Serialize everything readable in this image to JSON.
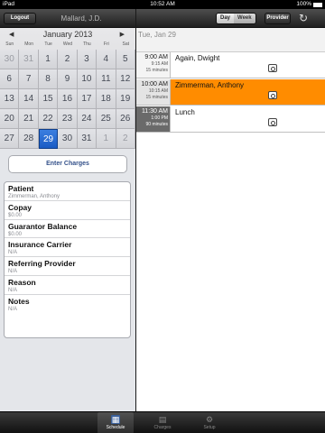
{
  "status_bar": {
    "device": "iPad",
    "time": "10:52 AM",
    "battery": "100%"
  },
  "left_nav": {
    "logout_label": "Logout",
    "provider_name": "Mallard, J.D."
  },
  "calendar": {
    "month_label": "January 2013",
    "prev_arrow": "◀",
    "next_arrow": "▶",
    "weekdays": [
      "Sun",
      "Mon",
      "Tue",
      "Wed",
      "Thu",
      "Fri",
      "Sat"
    ],
    "weeks": [
      [
        "30",
        "31",
        "1",
        "2",
        "3",
        "4",
        "5"
      ],
      [
        "6",
        "7",
        "8",
        "9",
        "10",
        "11",
        "12"
      ],
      [
        "13",
        "14",
        "15",
        "16",
        "17",
        "18",
        "19"
      ],
      [
        "20",
        "21",
        "22",
        "23",
        "24",
        "25",
        "26"
      ],
      [
        "27",
        "28",
        "29",
        "30",
        "31",
        "1",
        "2"
      ]
    ],
    "selected_day": "29"
  },
  "enter_charges_label": "Enter Charges",
  "info": [
    {
      "label": "Patient",
      "value": "Zimmerman, Anthony"
    },
    {
      "label": "Copay",
      "value": "$0.00"
    },
    {
      "label": "Guarantor Balance",
      "value": "$0.00"
    },
    {
      "label": "Insurance Carrier",
      "value": "N/A"
    },
    {
      "label": "Referring Provider",
      "value": "N/A"
    },
    {
      "label": "Reason",
      "value": "N/A"
    },
    {
      "label": "Notes",
      "value": "N/A"
    }
  ],
  "right_nav": {
    "day_label": "Day",
    "week_label": "Week",
    "provider_label": "Provider",
    "view": "Day"
  },
  "schedule": {
    "date_label": "Tue, Jan  29",
    "appointments": [
      {
        "start": "9:00 AM",
        "end": "9:15 AM",
        "duration": "15 minutes",
        "name": "Again, Dwight",
        "style": "normal"
      },
      {
        "start": "10:00 AM",
        "end": "10:15 AM",
        "duration": "15 minutes",
        "name": "Zimmerman, Anthony",
        "style": "highlight"
      },
      {
        "start": "11:30 AM",
        "end": "1:00 PM",
        "duration": "90 minutes",
        "name": "Lunch",
        "style": "lunch"
      }
    ]
  },
  "tabbar": {
    "tabs": [
      {
        "label": "Schedule",
        "icon": "calendar-icon",
        "active": true
      },
      {
        "label": "Charges",
        "icon": "calculator-icon",
        "active": false
      },
      {
        "label": "Setup",
        "icon": "gear-icon",
        "active": false
      }
    ]
  },
  "colors": {
    "highlight": "#ff8c00",
    "selected_day": "#1a5bc4"
  }
}
